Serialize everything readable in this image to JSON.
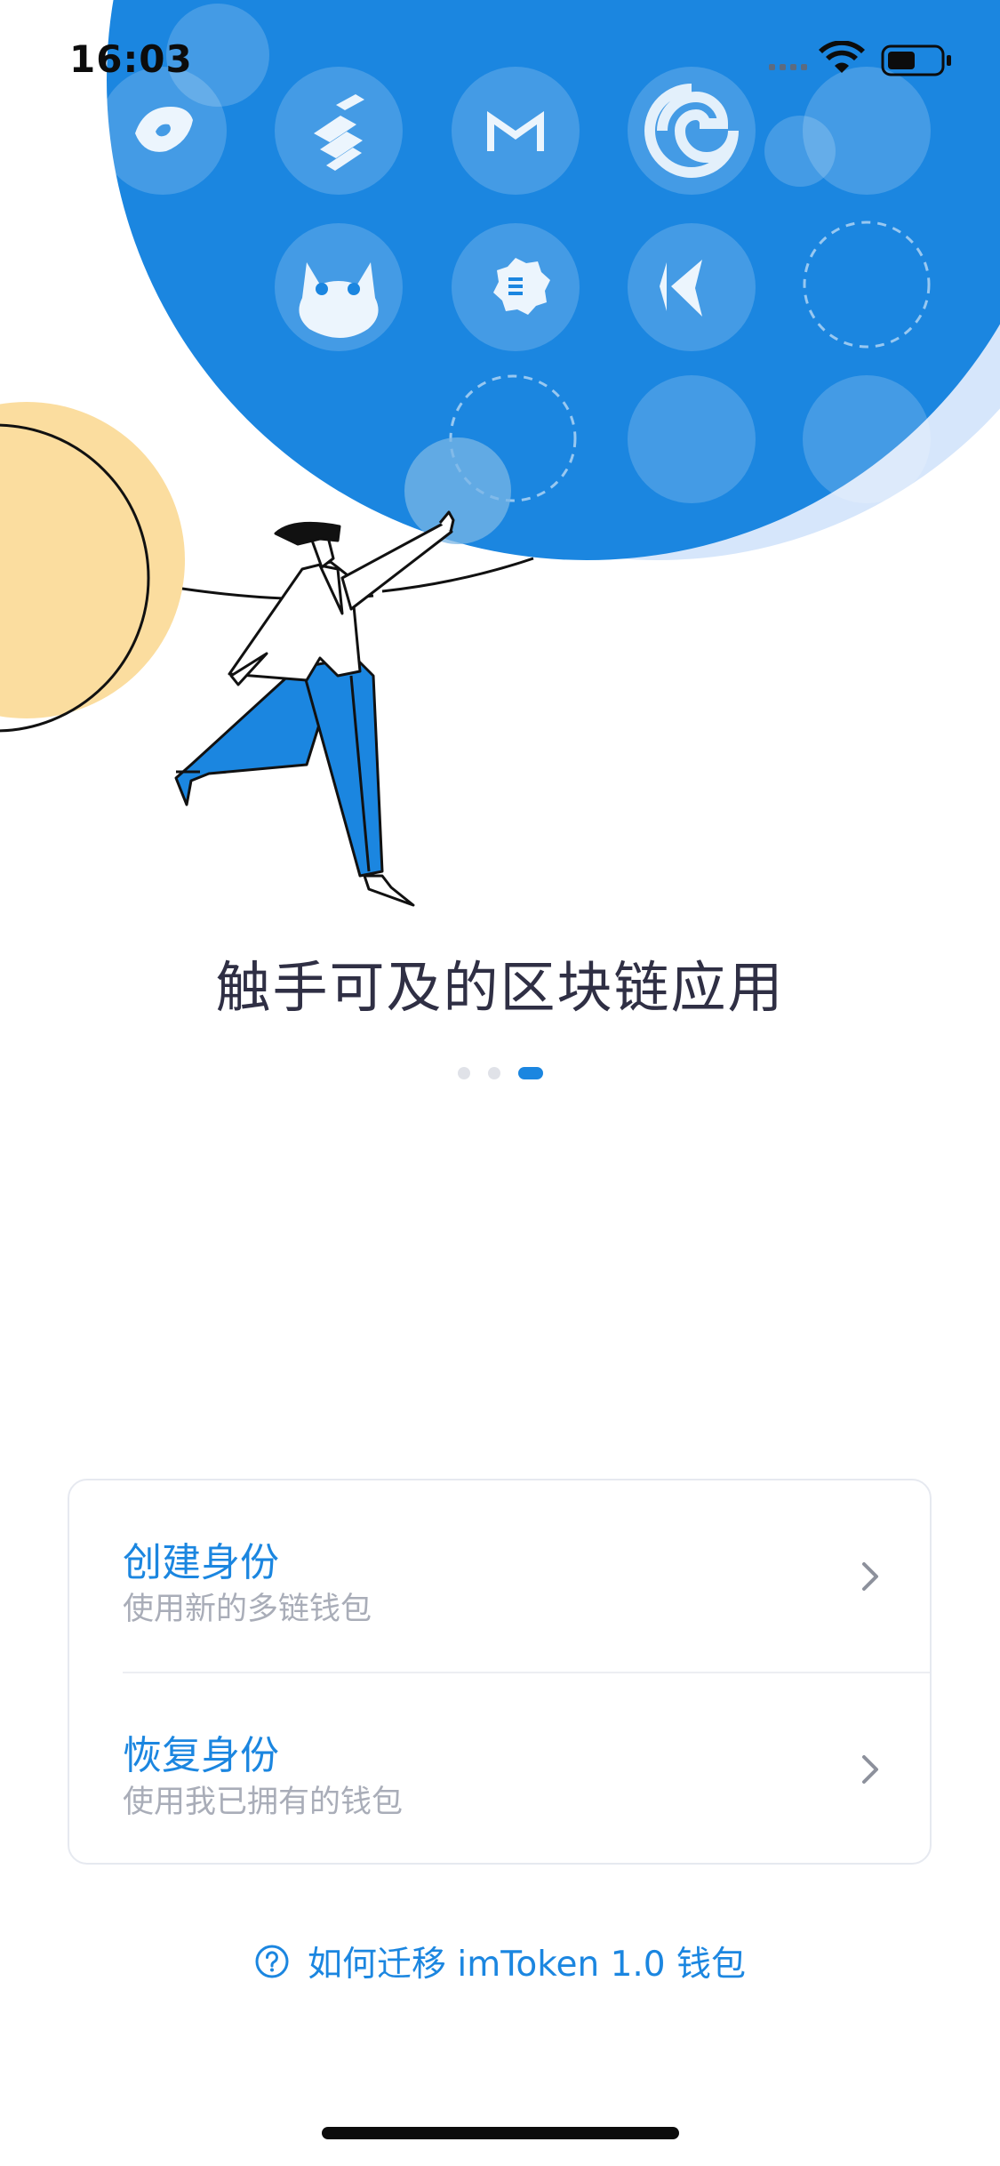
{
  "status_bar": {
    "time": "16:03"
  },
  "illustration": {
    "colors": {
      "blue": "#1b86e0",
      "yellow": "#fbdd9f",
      "light_blue": "#d6e6fb"
    },
    "app_icons": [
      "cube-icon",
      "stack-icon",
      "maker-icon",
      "swirl-icon",
      "cat-icon",
      "gear-icon",
      "kyber-icon"
    ]
  },
  "onboarding": {
    "headline": "触手可及的区块链应用",
    "pages": 3,
    "active_page": 3
  },
  "options": [
    {
      "title": "创建身份",
      "subtitle": "使用新的多链钱包"
    },
    {
      "title": "恢复身份",
      "subtitle": "使用我已拥有的钱包"
    }
  ],
  "help_link": "如何迁移 imToken 1.0 钱包",
  "colors": {
    "accent": "#1b86e0",
    "muted": "#a9adb8",
    "text": "#2f2f44"
  }
}
